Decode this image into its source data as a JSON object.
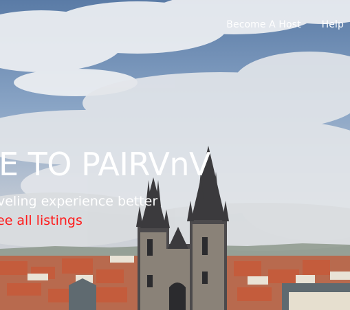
{
  "nav": {
    "host_label": "Become A Host",
    "help_label": "Help"
  },
  "hero": {
    "title": "E TO PAIRVnV",
    "subtitle": "veling experience better",
    "link_label": "ee all listings"
  },
  "colors": {
    "sky": "#6f8fb5",
    "link": "#ff1a1a",
    "text": "#ffffff",
    "roofs": "#b8553c"
  }
}
